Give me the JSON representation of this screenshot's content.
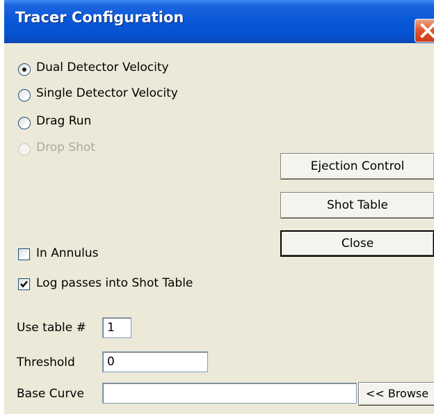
{
  "window": {
    "title": "Tracer Configuration"
  },
  "modes": [
    {
      "label": "Dual Detector Velocity",
      "selected": true,
      "enabled": true
    },
    {
      "label": "Single Detector Velocity",
      "selected": false,
      "enabled": true
    },
    {
      "label": "Drag Run",
      "selected": false,
      "enabled": true
    },
    {
      "label": "Drop Shot",
      "selected": false,
      "enabled": false
    }
  ],
  "options": {
    "in_annulus": {
      "label": "In Annulus",
      "checked": false
    },
    "log_passes": {
      "label": "Log passes into Shot Table",
      "checked": true
    }
  },
  "buttons": {
    "ejection_control": "Ejection Control",
    "shot_table": "Shot Table",
    "close": "Close",
    "browse": "<< Browse"
  },
  "fields": {
    "use_table": {
      "label": "Use table #",
      "value": "1"
    },
    "threshold": {
      "label": "Threshold",
      "value": "0"
    },
    "base_curve": {
      "label": "Base Curve",
      "value": ""
    }
  }
}
